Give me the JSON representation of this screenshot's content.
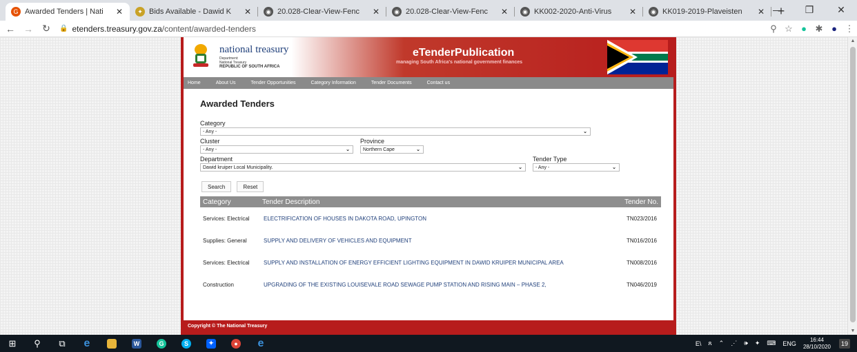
{
  "browser": {
    "tabs": [
      {
        "title": "Awarded Tenders | Nati",
        "active": true
      },
      {
        "title": "Bids Available - Dawid K"
      },
      {
        "title": "20.028-Clear-View-Fenc"
      },
      {
        "title": "20.028-Clear-View-Fenc"
      },
      {
        "title": "KK002-2020-Anti-Virus"
      },
      {
        "title": "KK019-2019-Plaveisten"
      }
    ],
    "new_tab": "+",
    "url_host": "etenders.treasury.gov.za",
    "url_path": "/content/awarded-tenders"
  },
  "site": {
    "logo_title": "national treasury",
    "logo_sub1": "Department:",
    "logo_sub2": "National Treasury",
    "logo_sub3": "REPUBLIC OF SOUTH AFRICA",
    "brand": "eTenderPublication",
    "tagline": "managing South Africa's national government finances",
    "menu": [
      "Home",
      "About Us",
      "Tender Opportunities",
      "Category Information",
      "Tender Documents",
      "Contact us"
    ],
    "footer": "Copyright © The National Treasury"
  },
  "form": {
    "page_title": "Awarded Tenders",
    "category_label": "Category",
    "category_value": "- Any -",
    "cluster_label": "Cluster",
    "cluster_value": "- Any -",
    "province_label": "Province",
    "province_value": "Northern Cape",
    "department_label": "Department",
    "department_value": "Dawid kruiper Local Municipality.",
    "tender_type_label": "Tender Type",
    "tender_type_value": "- Any -",
    "search_label": "Search",
    "reset_label": "Reset"
  },
  "table": {
    "headers": [
      "Category",
      "Tender Description",
      "Tender No."
    ],
    "rows": [
      {
        "category": "Services: Electrical",
        "description": "ELECTRIFICATION OF HOUSES IN DAKOTA ROAD, UPINGTON",
        "number": "TN023/2016"
      },
      {
        "category": "Supplies: General",
        "description": "SUPPLY AND DELIVERY OF VEHICLES AND EQUIPMENT",
        "number": "TN016/2016"
      },
      {
        "category": "Services: Electrical",
        "description": "SUPPLY AND INSTALLATION OF ENERGY EFFICIENT LIGHTING EQUIPMENT IN DAWID KRUIPER MUNICIPAL AREA",
        "number": "TN008/2016"
      },
      {
        "category": "Construction",
        "description": "UPGRADING OF THE EXISTING LOUISEVALE ROAD SEWAGE PUMP STATION AND RISING MAIN – PHASE 2,",
        "number": "TN046/2019"
      }
    ]
  },
  "taskbar": {
    "lang": "ENG",
    "time": "16:44",
    "date": "28/10/2020",
    "notifications": "19"
  },
  "colors": {
    "brand_red": "#b71c1c",
    "link_blue": "#1f3f7a",
    "header_gray": "#8e8e8e"
  }
}
